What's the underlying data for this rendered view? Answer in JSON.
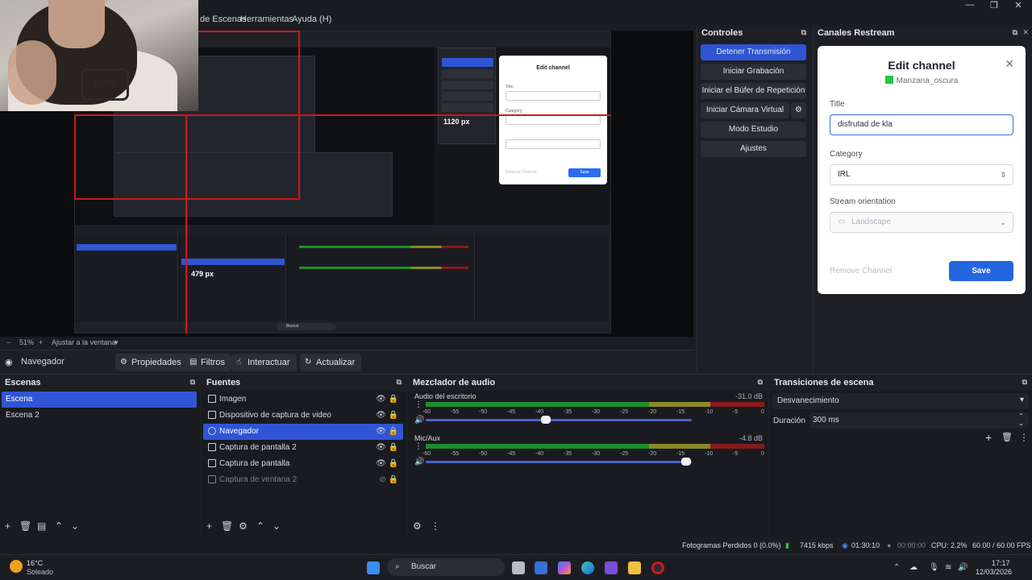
{
  "menu": {
    "items": [
      "de Escenas",
      "Herramientas",
      "Ayuda (H)"
    ],
    "window_controls": [
      "—",
      "❐",
      "✕"
    ]
  },
  "preview": {
    "zoom": "51%",
    "fit_label": "Ajustar a la ventana",
    "nested_texts": {
      "size_readout": "479 px",
      "size_readout2": "1120 px",
      "modal_title": "Edit channel",
      "modal_save": "Save",
      "modal_remove": "Remove Channel",
      "taskbar_search": "Buscar"
    },
    "webcam_print": "DUST"
  },
  "source_toolbar": {
    "source_name": "Navegador",
    "buttons": [
      "Propiedades",
      "Filtros",
      "Interactuar",
      "Actualizar"
    ]
  },
  "controls": {
    "header": "Controles",
    "buttons": [
      "Detener Transmisión",
      "Iniciar Grabación",
      "Iniciar el Búfer de Repetición",
      "Iniciar Cámara Virtual",
      "Modo Estudio",
      "Ajustes"
    ]
  },
  "restream": {
    "header": "Canales Restream",
    "modal": {
      "title": "Edit channel",
      "channel": "Manzana_oscura",
      "title_label": "Title",
      "title_value": "disfrutad de kla",
      "category_label": "Category",
      "category_value": "IRL",
      "orientation_label": "Stream orientation",
      "orientation_value": "Landscape",
      "remove": "Remove Channel",
      "save": "Save"
    }
  },
  "scenes": {
    "header": "Escenas",
    "items": [
      "Escena",
      "Escena 2"
    ]
  },
  "sources": {
    "header": "Fuentes",
    "items": [
      {
        "name": "Imagen",
        "icon": "image-icon"
      },
      {
        "name": "Dispositivo de captura de video",
        "icon": "camera-icon"
      },
      {
        "name": "Navegador",
        "icon": "globe-icon"
      },
      {
        "name": "Captura de pantalla 2",
        "icon": "monitor-icon"
      },
      {
        "name": "Captura de pantalla",
        "icon": "monitor-icon"
      },
      {
        "name": "Captura de ventana 2",
        "icon": "window-icon"
      }
    ]
  },
  "mixer": {
    "header": "Mezclador de audio",
    "channels": [
      {
        "name": "Audio del escritorio",
        "db": "-31.0 dB",
        "volume": 0.45
      },
      {
        "name": "Mic/Aux",
        "db": "-4.8 dB",
        "volume": 0.98
      }
    ],
    "scale": [
      "-60",
      "-55",
      "-50",
      "-45",
      "-40",
      "-35",
      "-30",
      "-25",
      "-20",
      "-15",
      "-10",
      "-5",
      "0"
    ]
  },
  "transitions": {
    "header": "Transiciones de escena",
    "selected": "Desvanecimiento",
    "duration_label": "Duración",
    "duration_value": "300 ms"
  },
  "status": {
    "dropped": "Fotogramas Perdidos 0 (0.0%)",
    "bitrate": "7415 kbps",
    "stream_time": "01:30:10",
    "rec_time": "00:00:00",
    "cpu": "CPU: 2.2%",
    "fps": "60.00 / 60.00 FPS"
  },
  "taskbar": {
    "weather_temp": "16°C",
    "weather_desc": "Soleado",
    "search": "Buscar",
    "time": "17:17",
    "date": "12/03/2026"
  },
  "colors": {
    "accent": "#2f55d4",
    "save": "#2366e0",
    "live_red": "#d2161e"
  }
}
